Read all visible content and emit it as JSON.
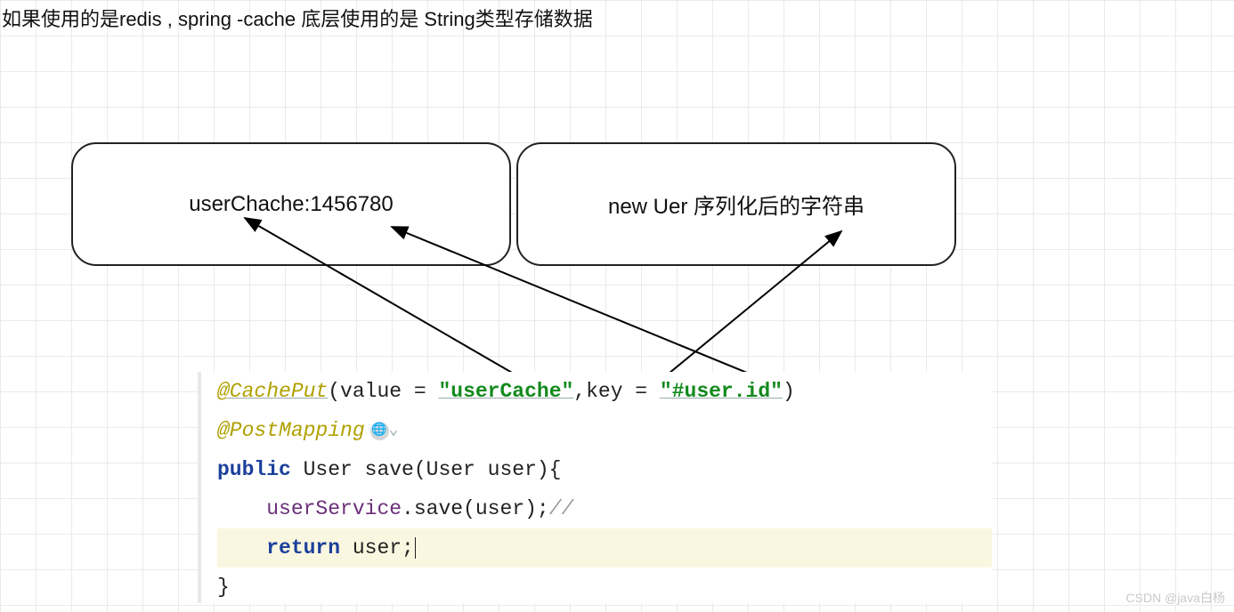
{
  "title": "如果使用的是redis , spring -cache  底层使用的是 String类型存储数据",
  "box_left": "userChache:1456780",
  "box_right": "new Uer 序列化后的字符串",
  "code": {
    "anno1_open": "@CachePut",
    "anno1_args_prefix": "(value = ",
    "anno1_val": "\"userCache\"",
    "anno1_mid": ",key = ",
    "anno1_key": "\"#user.id\"",
    "anno1_close": ")",
    "anno2": "@PostMapping",
    "sig_kw": "public",
    "sig_rest": " User save(User user){",
    "call_obj": "userService",
    "call_rest": ".save(user);",
    "call_cmt": "//",
    "ret_kw": "return",
    "ret_rest": " user;",
    "brace": "}"
  },
  "watermark": "CSDN @java白杨"
}
